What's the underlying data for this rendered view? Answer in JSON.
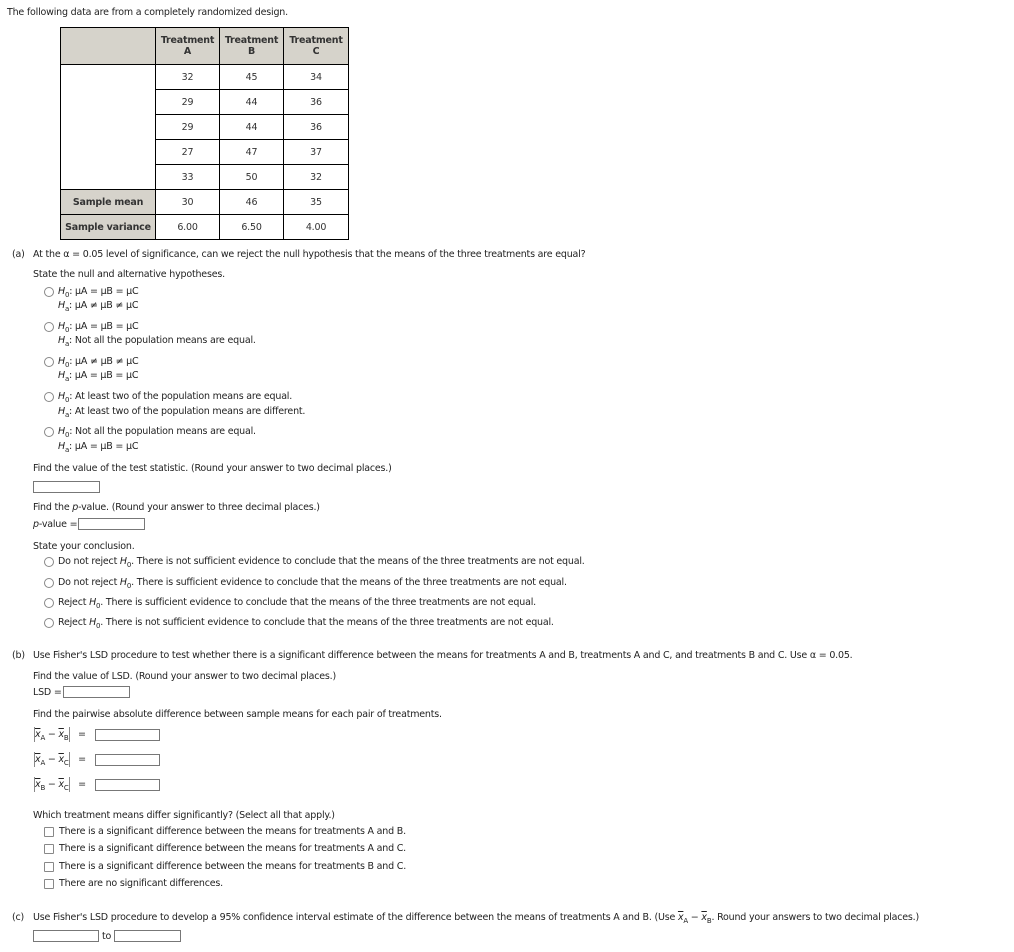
{
  "intro": "The following data are from a completely randomized design.",
  "table": {
    "headers": [
      {
        "line1": "Treatment",
        "line2": "A"
      },
      {
        "line1": "Treatment",
        "line2": "B"
      },
      {
        "line1": "Treatment",
        "line2": "C"
      }
    ],
    "observations": [
      [
        "32",
        "45",
        "34"
      ],
      [
        "29",
        "44",
        "36"
      ],
      [
        "29",
        "44",
        "36"
      ],
      [
        "27",
        "47",
        "37"
      ],
      [
        "33",
        "50",
        "32"
      ]
    ],
    "mean_label": "Sample mean",
    "means": [
      "30",
      "46",
      "35"
    ],
    "variance_label": "Sample variance",
    "variances": [
      "6.00",
      "6.50",
      "4.00"
    ]
  },
  "part_a": {
    "label": "(a)",
    "question": "At the α = 0.05 level of significance, can we reject the null hypothesis that the means of the three treatments are equal?",
    "hyp_prompt": "State the null and alternative hypotheses.",
    "hyp_options": [
      {
        "h0": ": μA = μB = μC",
        "ha": ": μA ≠ μB ≠ μC"
      },
      {
        "h0": ": μA = μB = μC",
        "ha": ": Not all the population means are equal."
      },
      {
        "h0": ": μA ≠ μB ≠ μC",
        "ha": ": μA = μB = μC"
      },
      {
        "h0": ": At least two of the population means are equal.",
        "ha": ": At least two of the population means are different."
      },
      {
        "h0": ": Not all the population means are equal.",
        "ha": ": μA = μB = μC"
      }
    ],
    "test_stat_prompt": "Find the value of the test statistic. (Round your answer to two decimal places.)",
    "test_stat_value": "",
    "pvalue_prompt_pre": "Find the ",
    "pvalue_prompt_p": "p",
    "pvalue_prompt_post": "-value. (Round your answer to three decimal places.)",
    "pvalue_label_p": "p",
    "pvalue_label_post": "-value =",
    "pvalue_value": "",
    "conclusion_prompt": "State your conclusion.",
    "conclusions": [
      {
        "pre": "Do not reject ",
        "post": ". There is not sufficient evidence to conclude that the means of the three treatments are not equal."
      },
      {
        "pre": "Do not reject ",
        "post": ". There is sufficient evidence to conclude that the means of the three treatments are not equal."
      },
      {
        "pre": "Reject ",
        "post": ". There is sufficient evidence to conclude that the means of the three treatments are not equal."
      },
      {
        "pre": "Reject ",
        "post": ". There is not sufficient evidence to conclude that the means of the three treatments are not equal."
      }
    ]
  },
  "part_b": {
    "label": "(b)",
    "question": "Use Fisher's LSD procedure to test whether there is a significant difference between the means for treatments A and B, treatments A and C, and treatments B and C. Use α = 0.05.",
    "lsd_prompt": "Find the value of LSD. (Round your answer to two decimal places.)",
    "lsd_label": "LSD =",
    "lsd_value": "",
    "pairwise_prompt": "Find the pairwise absolute difference between sample means for each pair of treatments.",
    "pairs": [
      {
        "a": "A",
        "b": "B",
        "value": ""
      },
      {
        "a": "A",
        "b": "C",
        "value": ""
      },
      {
        "a": "B",
        "b": "C",
        "value": ""
      }
    ],
    "differ_prompt": "Which treatment means differ significantly? (Select all that apply.)",
    "differ_options": [
      "There is a significant difference between the means for treatments A and B.",
      "There is a significant difference between the means for treatments A and C.",
      "There is a significant difference between the means for treatments B and C.",
      "There are no significant differences."
    ]
  },
  "part_c": {
    "label": "(c)",
    "question_pre": "Use Fisher's LSD procedure to develop a 95% confidence interval estimate of the difference between the means of treatments A and B. (Use ",
    "question_post": ". Round your answers to two decimal places.)",
    "to_label": "to",
    "lower_value": "",
    "upper_value": ""
  },
  "symbols": {
    "x": "x",
    "h": "H",
    "zero": "0",
    "a": "a",
    "minus": "−",
    "equals": "="
  }
}
